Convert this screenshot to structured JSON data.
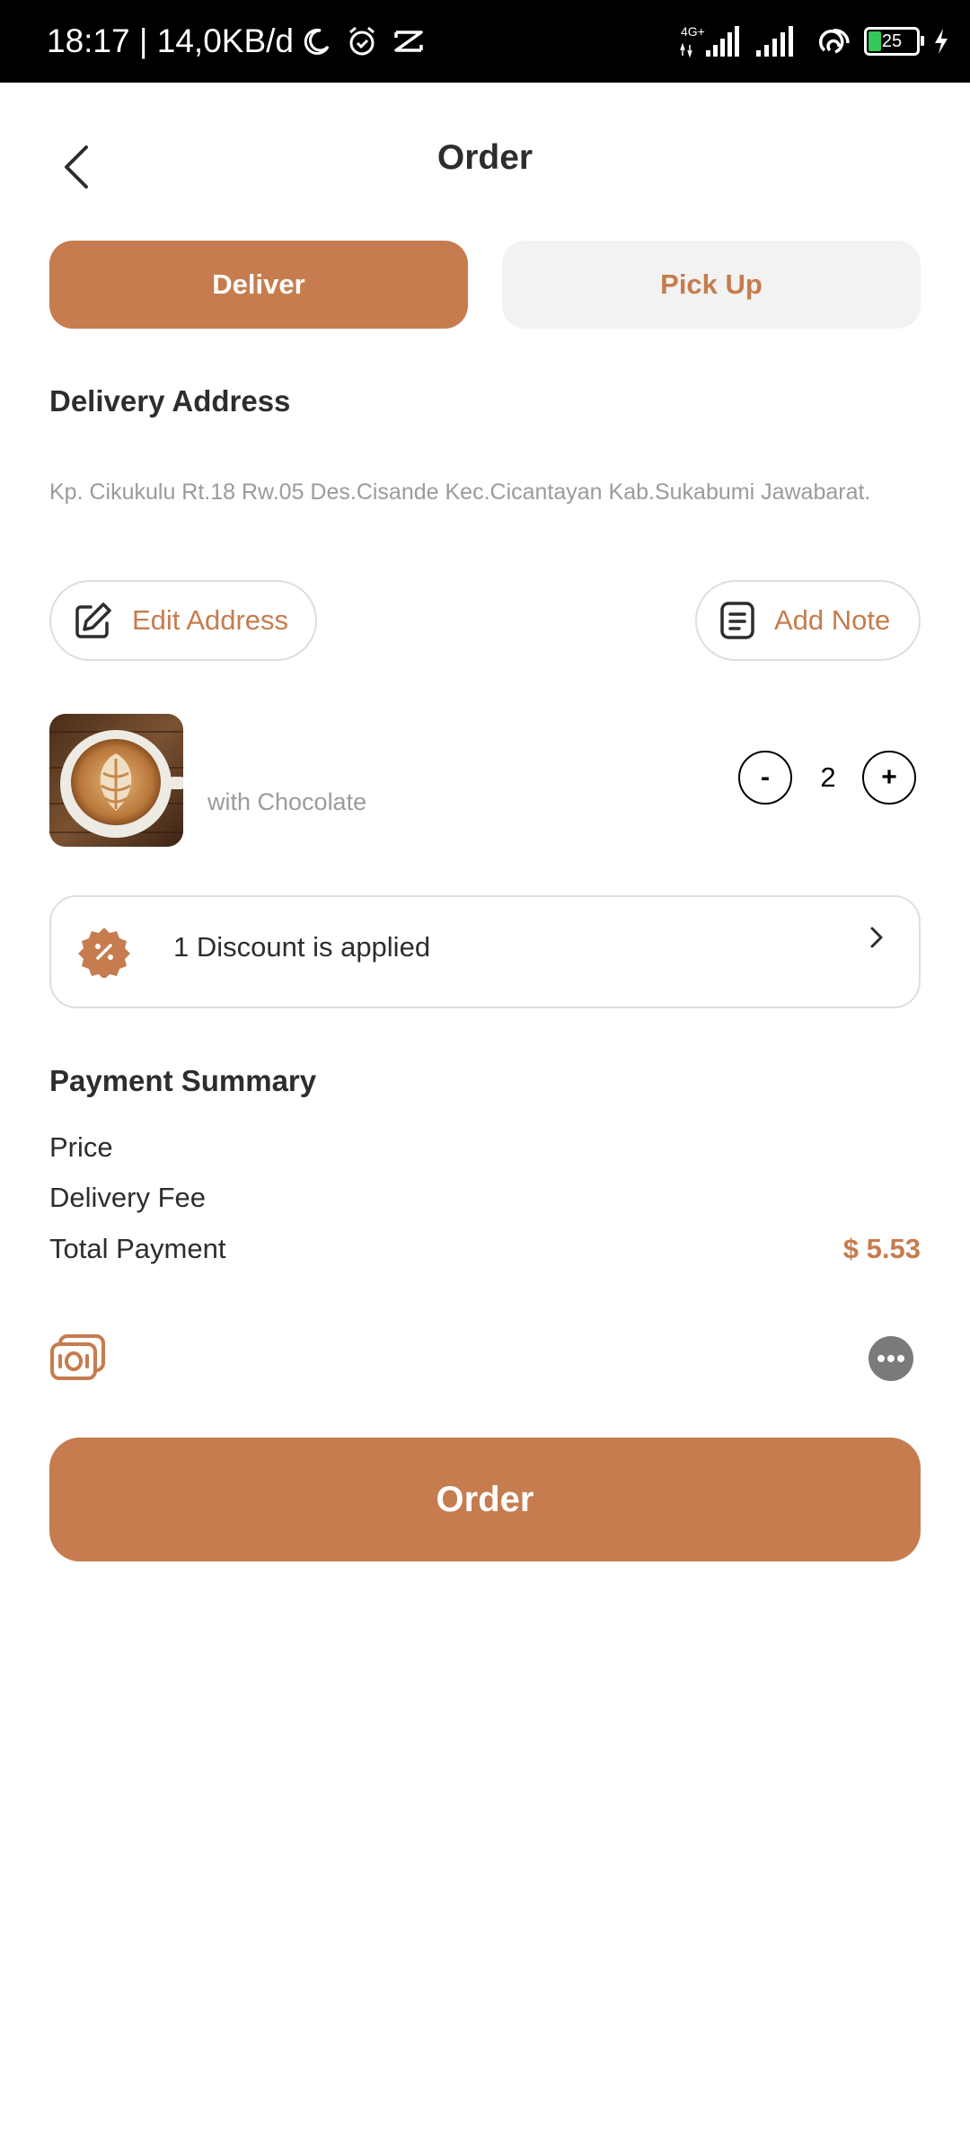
{
  "status_bar": {
    "time_net": "18:17 | 14,0KB/d",
    "network_type": "4G+",
    "battery": "25"
  },
  "header": {
    "title": "Order"
  },
  "tabs": {
    "deliver": "Deliver",
    "pickup": "Pick Up"
  },
  "delivery": {
    "section_title": "Delivery Address",
    "address": "Kp. Cikukulu Rt.18 Rw.05 Des.Cisande Kec.Cicantayan Kab.Sukabumi Jawabarat.",
    "edit_label": "Edit Address",
    "note_label": "Add Note"
  },
  "item": {
    "variant": "with Chocolate",
    "minus": "-",
    "plus": "+",
    "quantity": "2"
  },
  "discount": {
    "label": "1 Discount is applied"
  },
  "payment": {
    "title": "Payment Summary",
    "price_label": "Price",
    "delivery_fee_label": "Delivery Fee",
    "total_label": "Total Payment",
    "total_value": "$ 5.53"
  },
  "order_button": "Order",
  "colors": {
    "accent": "#c67c4e",
    "text": "#2f2d2c",
    "muted": "#9b9b9b"
  }
}
